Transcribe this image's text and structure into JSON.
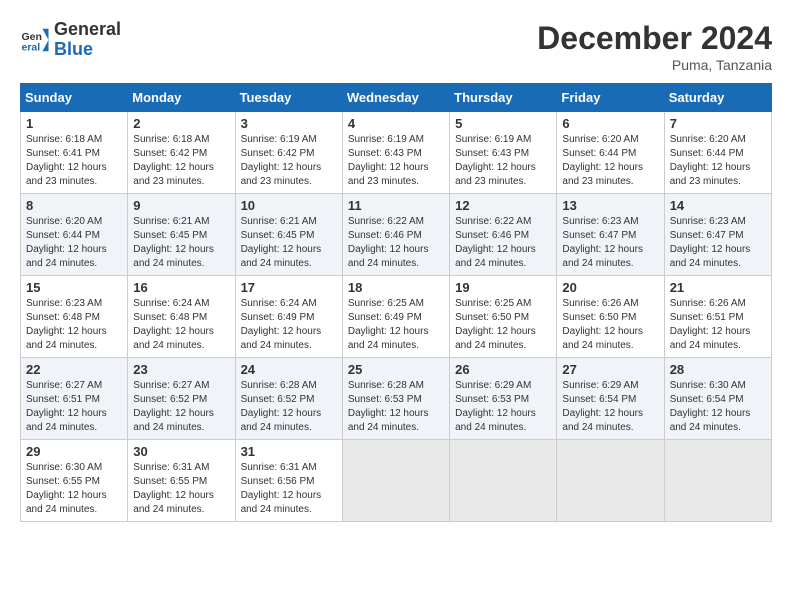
{
  "logo": {
    "line1": "General",
    "line2": "Blue"
  },
  "title": "December 2024",
  "subtitle": "Puma, Tanzania",
  "days_of_week": [
    "Sunday",
    "Monday",
    "Tuesday",
    "Wednesday",
    "Thursday",
    "Friday",
    "Saturday"
  ],
  "weeks": [
    [
      {
        "day": "1",
        "info": "Sunrise: 6:18 AM\nSunset: 6:41 PM\nDaylight: 12 hours\nand 23 minutes."
      },
      {
        "day": "2",
        "info": "Sunrise: 6:18 AM\nSunset: 6:42 PM\nDaylight: 12 hours\nand 23 minutes."
      },
      {
        "day": "3",
        "info": "Sunrise: 6:19 AM\nSunset: 6:42 PM\nDaylight: 12 hours\nand 23 minutes."
      },
      {
        "day": "4",
        "info": "Sunrise: 6:19 AM\nSunset: 6:43 PM\nDaylight: 12 hours\nand 23 minutes."
      },
      {
        "day": "5",
        "info": "Sunrise: 6:19 AM\nSunset: 6:43 PM\nDaylight: 12 hours\nand 23 minutes."
      },
      {
        "day": "6",
        "info": "Sunrise: 6:20 AM\nSunset: 6:44 PM\nDaylight: 12 hours\nand 23 minutes."
      },
      {
        "day": "7",
        "info": "Sunrise: 6:20 AM\nSunset: 6:44 PM\nDaylight: 12 hours\nand 23 minutes."
      }
    ],
    [
      {
        "day": "8",
        "info": "Sunrise: 6:20 AM\nSunset: 6:44 PM\nDaylight: 12 hours\nand 24 minutes."
      },
      {
        "day": "9",
        "info": "Sunrise: 6:21 AM\nSunset: 6:45 PM\nDaylight: 12 hours\nand 24 minutes."
      },
      {
        "day": "10",
        "info": "Sunrise: 6:21 AM\nSunset: 6:45 PM\nDaylight: 12 hours\nand 24 minutes."
      },
      {
        "day": "11",
        "info": "Sunrise: 6:22 AM\nSunset: 6:46 PM\nDaylight: 12 hours\nand 24 minutes."
      },
      {
        "day": "12",
        "info": "Sunrise: 6:22 AM\nSunset: 6:46 PM\nDaylight: 12 hours\nand 24 minutes."
      },
      {
        "day": "13",
        "info": "Sunrise: 6:23 AM\nSunset: 6:47 PM\nDaylight: 12 hours\nand 24 minutes."
      },
      {
        "day": "14",
        "info": "Sunrise: 6:23 AM\nSunset: 6:47 PM\nDaylight: 12 hours\nand 24 minutes."
      }
    ],
    [
      {
        "day": "15",
        "info": "Sunrise: 6:23 AM\nSunset: 6:48 PM\nDaylight: 12 hours\nand 24 minutes."
      },
      {
        "day": "16",
        "info": "Sunrise: 6:24 AM\nSunset: 6:48 PM\nDaylight: 12 hours\nand 24 minutes."
      },
      {
        "day": "17",
        "info": "Sunrise: 6:24 AM\nSunset: 6:49 PM\nDaylight: 12 hours\nand 24 minutes."
      },
      {
        "day": "18",
        "info": "Sunrise: 6:25 AM\nSunset: 6:49 PM\nDaylight: 12 hours\nand 24 minutes."
      },
      {
        "day": "19",
        "info": "Sunrise: 6:25 AM\nSunset: 6:50 PM\nDaylight: 12 hours\nand 24 minutes."
      },
      {
        "day": "20",
        "info": "Sunrise: 6:26 AM\nSunset: 6:50 PM\nDaylight: 12 hours\nand 24 minutes."
      },
      {
        "day": "21",
        "info": "Sunrise: 6:26 AM\nSunset: 6:51 PM\nDaylight: 12 hours\nand 24 minutes."
      }
    ],
    [
      {
        "day": "22",
        "info": "Sunrise: 6:27 AM\nSunset: 6:51 PM\nDaylight: 12 hours\nand 24 minutes."
      },
      {
        "day": "23",
        "info": "Sunrise: 6:27 AM\nSunset: 6:52 PM\nDaylight: 12 hours\nand 24 minutes."
      },
      {
        "day": "24",
        "info": "Sunrise: 6:28 AM\nSunset: 6:52 PM\nDaylight: 12 hours\nand 24 minutes."
      },
      {
        "day": "25",
        "info": "Sunrise: 6:28 AM\nSunset: 6:53 PM\nDaylight: 12 hours\nand 24 minutes."
      },
      {
        "day": "26",
        "info": "Sunrise: 6:29 AM\nSunset: 6:53 PM\nDaylight: 12 hours\nand 24 minutes."
      },
      {
        "day": "27",
        "info": "Sunrise: 6:29 AM\nSunset: 6:54 PM\nDaylight: 12 hours\nand 24 minutes."
      },
      {
        "day": "28",
        "info": "Sunrise: 6:30 AM\nSunset: 6:54 PM\nDaylight: 12 hours\nand 24 minutes."
      }
    ],
    [
      {
        "day": "29",
        "info": "Sunrise: 6:30 AM\nSunset: 6:55 PM\nDaylight: 12 hours\nand 24 minutes."
      },
      {
        "day": "30",
        "info": "Sunrise: 6:31 AM\nSunset: 6:55 PM\nDaylight: 12 hours\nand 24 minutes."
      },
      {
        "day": "31",
        "info": "Sunrise: 6:31 AM\nSunset: 6:56 PM\nDaylight: 12 hours\nand 24 minutes."
      },
      {
        "day": "",
        "info": ""
      },
      {
        "day": "",
        "info": ""
      },
      {
        "day": "",
        "info": ""
      },
      {
        "day": "",
        "info": ""
      }
    ]
  ]
}
